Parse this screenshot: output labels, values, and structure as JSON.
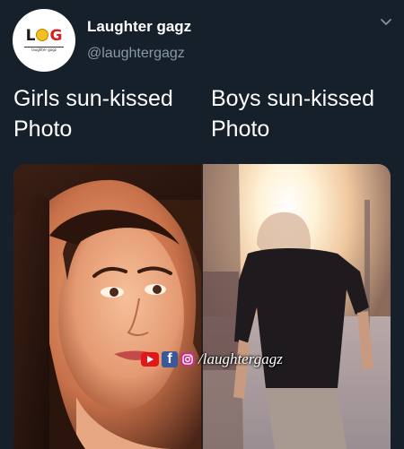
{
  "account": {
    "display_name": "Laughter gagz",
    "handle": "@laughtergagz",
    "avatar_logo": {
      "left": "L",
      "right": "G",
      "tagline": "laughter gagz"
    }
  },
  "tweet": {
    "caption_left": "Girls sun-kissed Photo",
    "caption_right": "Boys sun-kissed Photo"
  },
  "media": {
    "left_photo": "girl-sunkissed-portrait",
    "right_photo": "boy-sun-blocked-face",
    "watermark": {
      "icons": [
        "youtube-icon",
        "facebook-icon",
        "instagram-icon"
      ],
      "facebook_glyph": "f",
      "text": "/laughtergagz"
    }
  },
  "colors": {
    "background": "#15202b",
    "secondary_text": "#8899a6",
    "youtube_red": "#e01818",
    "facebook_blue": "#3b5998",
    "instagram_pink": "#c13584",
    "logo_gold": "#f0c020",
    "logo_red": "#d62020"
  }
}
